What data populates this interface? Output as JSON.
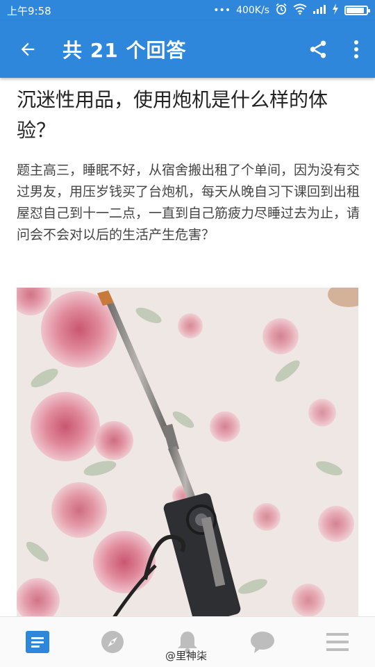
{
  "status_bar": {
    "time": "上午9:58",
    "dots": "•••",
    "speed": "400K/s",
    "battery_level": 0.9
  },
  "app_bar": {
    "title": "共 21 个回答",
    "back_icon": "arrow-left-icon",
    "share_icon": "share-icon",
    "more_icon": "more-vert-icon"
  },
  "question": {
    "title": "沉迷性用品，使用炮机是什么样的体验？",
    "detail": "题主高三，睡眠不好，从宿舍搬出租了个单间，因为没有交过男友，用压岁钱买了台炮机，每天从晚自习下课回到出租屋怼自己到十一二点，一直到自己筋疲力尽睡过去为止，请问会不会对以后的生活产生危害？"
  },
  "bottom_nav": {
    "items": [
      {
        "icon": "feed-icon",
        "active": true
      },
      {
        "icon": "compass-icon",
        "active": false
      },
      {
        "icon": "bell-icon",
        "active": false
      },
      {
        "icon": "chat-icon",
        "active": false
      },
      {
        "icon": "menu-icon",
        "active": false
      }
    ]
  },
  "watermark": "@里神柒",
  "colors": {
    "primary": "#2f87dc",
    "active_nav": "#2f87dc",
    "inactive_nav": "#bdbdbd"
  }
}
